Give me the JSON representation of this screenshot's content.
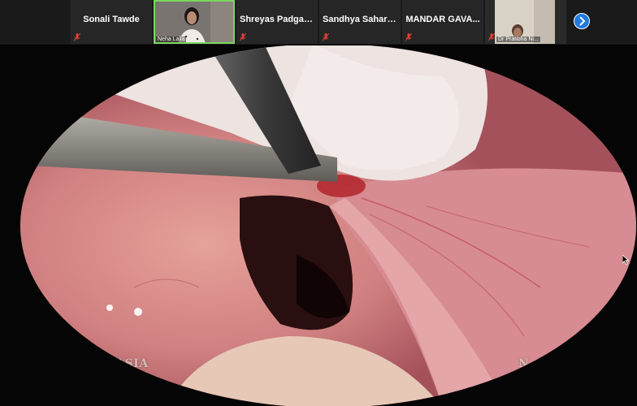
{
  "participants": [
    {
      "name": "Sonali Tawde",
      "muted": true,
      "video": false
    },
    {
      "name": "Neha Lalla",
      "muted": false,
      "video": true,
      "active": true
    },
    {
      "name": "Shreyas Padgao...",
      "muted": true,
      "video": false
    },
    {
      "name": "Sandhya Saharan",
      "muted": true,
      "video": false
    },
    {
      "name": "MANDAR GAVA...",
      "muted": true,
      "video": false
    },
    {
      "name": "Dr Pratibha Ni...",
      "muted": true,
      "video": true
    }
  ],
  "next_button_icon": "chevron-right-icon",
  "video": {
    "watermark_left": "H. VAGHASIA",
    "watermark_right": "N. LALLA"
  },
  "colors": {
    "strip_bg": "#1a1a1a",
    "active_border": "#7bd65f",
    "muted_mic": "#e0403a",
    "next_button": "#1f7ae0"
  }
}
